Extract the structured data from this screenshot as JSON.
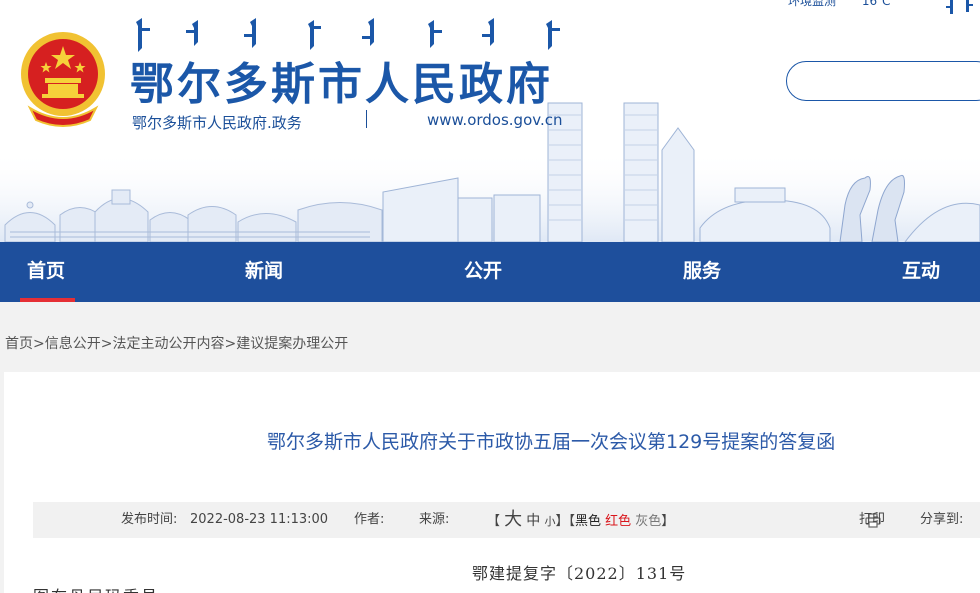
{
  "header": {
    "site_title": "鄂尔多斯市人民政府",
    "site_subtitle": "鄂尔多斯市人民政府.政务",
    "site_url": "www.ordos.gov.cn",
    "top_links": [
      "环境监测",
      "16℃"
    ],
    "emblem_icon": "national-emblem-icon",
    "colors": {
      "brand_blue": "#1b57a8",
      "nav_blue": "#1e4f9c",
      "accent_red": "#e52f35"
    }
  },
  "nav": {
    "items": [
      {
        "label": "首页",
        "active": true
      },
      {
        "label": "新闻",
        "active": false
      },
      {
        "label": "公开",
        "active": false
      },
      {
        "label": "服务",
        "active": false
      },
      {
        "label": "互动",
        "active": false
      }
    ]
  },
  "breadcrumb": {
    "items": [
      "首页",
      "信息公开",
      "法定主动公开内容",
      "建议提案办理公开"
    ],
    "separator": ">"
  },
  "article": {
    "title": "鄂尔多斯市人民政府关于市政协五届一次会议第129号提案的答复函",
    "meta": {
      "publish_label": "发布时间:",
      "publish_time": "2022-08-23 11:13:00",
      "author_label": "作者:",
      "source_label": "来源:",
      "size_open": "【",
      "size_big": "大",
      "size_mid": "中",
      "size_small": "小",
      "size_close": "】",
      "color_open": "【",
      "color_black": "黑色",
      "color_red": "红色",
      "color_gray": "灰色",
      "color_close": "】",
      "print_label": "打印",
      "share_label": "分享到:"
    },
    "doc_number": "鄂建提复字〔2022〕131号",
    "greeting": "图布丹尼玛委员:"
  }
}
